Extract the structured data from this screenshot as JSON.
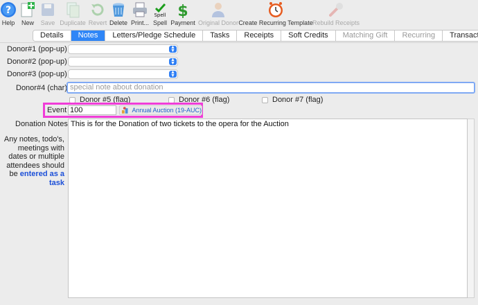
{
  "toolbar": {
    "items": [
      {
        "label": "Help",
        "icon": "help-icon",
        "enabled": true
      },
      {
        "label": "New",
        "icon": "new-icon",
        "enabled": true
      },
      {
        "label": "Save",
        "icon": "save-icon",
        "enabled": false
      },
      {
        "label": "Duplicate",
        "icon": "duplicate-icon",
        "enabled": false
      },
      {
        "label": "Revert",
        "icon": "revert-icon",
        "enabled": false
      },
      {
        "label": "Delete",
        "icon": "trash-icon",
        "enabled": true
      },
      {
        "label": "Print...",
        "icon": "print-icon",
        "enabled": true
      },
      {
        "label": "Spell",
        "icon": "spell-icon",
        "enabled": true,
        "icon_text": "Spell"
      },
      {
        "label": "Payment",
        "icon": "dollar-icon",
        "enabled": true
      },
      {
        "label": "Original Donor",
        "icon": "person-icon",
        "enabled": false
      },
      {
        "label": "Create Recurring Template",
        "icon": "clock-icon",
        "enabled": true
      },
      {
        "label": "Rebuild Receipts",
        "icon": "wrench-icon",
        "enabled": false
      }
    ]
  },
  "tabs": [
    {
      "label": "Details",
      "active": false,
      "enabled": true
    },
    {
      "label": "Notes",
      "active": true,
      "enabled": true
    },
    {
      "label": "Letters/Pledge Schedule",
      "active": false,
      "enabled": true
    },
    {
      "label": "Tasks",
      "active": false,
      "enabled": true
    },
    {
      "label": "Receipts",
      "active": false,
      "enabled": true
    },
    {
      "label": "Soft Credits",
      "active": false,
      "enabled": true
    },
    {
      "label": "Matching Gift",
      "active": false,
      "enabled": false
    },
    {
      "label": "Recurring",
      "active": false,
      "enabled": false
    },
    {
      "label": "Transactions",
      "active": false,
      "enabled": true
    }
  ],
  "form": {
    "donor1_label": "Donor#1 (pop-up)",
    "donor1_value": "",
    "donor2_label": "Donor#2 (pop-up)",
    "donor2_value": "",
    "donor3_label": "Donor#3 (pop-up)",
    "donor3_value": "",
    "donor4_label": "Donor#4 (char)",
    "donor4_placeholder": "special note about donation",
    "donor5_label": "Donor #5 (flag)",
    "donor6_label": "Donor #6 (flag)",
    "donor7_label": "Donor #7 (flag)",
    "event_label": "Event",
    "event_value": "100",
    "event_link": "Annual Auction (19-AUC)",
    "notes_label": "Donation Notes",
    "notes_value": "This is for the Donation of two tickets to the opera for the Auction",
    "help_text_prefix": "Any notes, todo's, meetings with dates or multiple attendees should be",
    "help_text_link": "entered as a task"
  },
  "colors": {
    "accent": "#2f86f7",
    "highlight": "#f03dd8",
    "link": "#1b4fd8"
  }
}
